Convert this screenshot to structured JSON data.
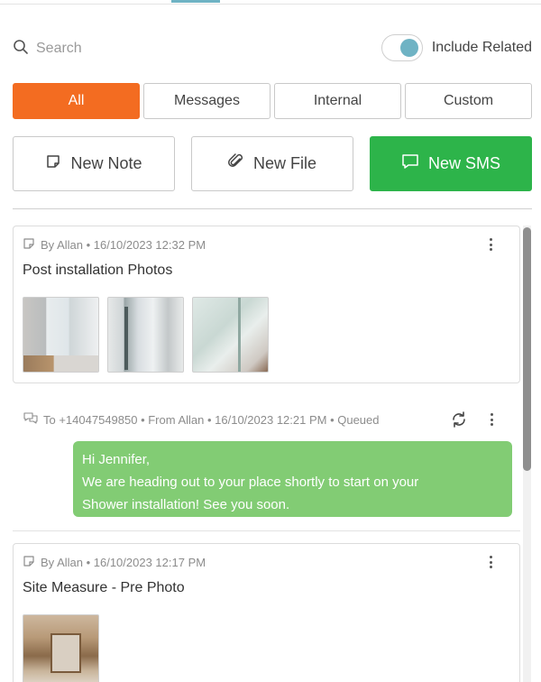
{
  "search": {
    "placeholder": "Search"
  },
  "include_related": {
    "label": "Include Related",
    "enabled": true
  },
  "filters": [
    {
      "label": "All",
      "active": true
    },
    {
      "label": "Messages",
      "active": false
    },
    {
      "label": "Internal",
      "active": false
    },
    {
      "label": "Custom",
      "active": false
    }
  ],
  "actions": {
    "new_note": "New Note",
    "new_file": "New File",
    "new_sms": "New SMS"
  },
  "colors": {
    "accent_orange": "#f36c21",
    "accent_green": "#2db44a",
    "sms_bubble": "#82cc74",
    "toggle_teal": "#6fb3c4"
  },
  "feed": {
    "items": [
      {
        "type": "note",
        "meta": "By Allan • 16/10/2023 12:32 PM",
        "title": "Post installation Photos",
        "icon": "note-icon",
        "photos": [
          "photo-1",
          "photo-2",
          "photo-3"
        ]
      },
      {
        "type": "sms",
        "meta": "To +14047549850 • From Allan • 16/10/2023 12:21 PM • Queued",
        "icon": "message-icon",
        "message_line1": "Hi Jennifer,",
        "message_line2": "We are heading out to your place shortly to start on your",
        "message_line3": "Shower installation! See you soon."
      },
      {
        "type": "note",
        "meta": "By Allan • 16/10/2023 12:17 PM",
        "title": "Site Measure - Pre Photo",
        "icon": "note-icon",
        "photos": [
          "photo-1"
        ]
      }
    ]
  }
}
